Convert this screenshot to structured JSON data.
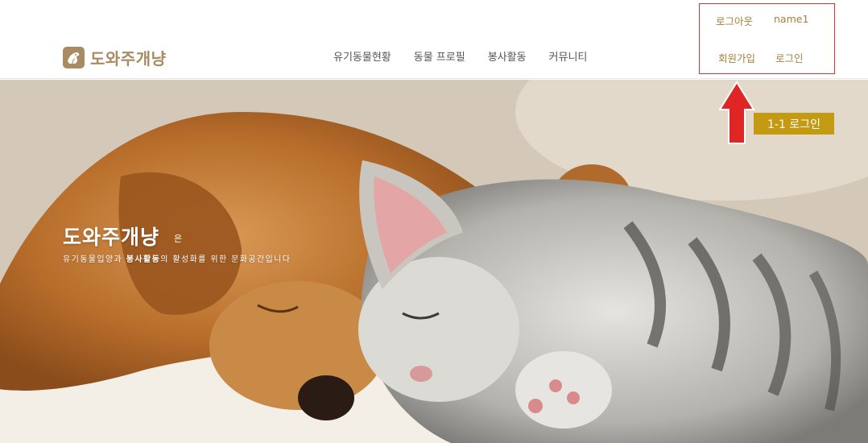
{
  "brand": {
    "name": "도와주개냥",
    "icon": "dog-cat-logo-icon",
    "color": "#a98b61"
  },
  "nav": {
    "items": [
      {
        "label": "유기동물현황"
      },
      {
        "label": "동물 프로필"
      },
      {
        "label": "봉사활동"
      },
      {
        "label": "커뮤니티"
      }
    ]
  },
  "auth": {
    "logout_label": "로그아웃",
    "user_name": "name1",
    "join_label": "회원가입",
    "login_label": "로그인",
    "link_color": "#a4803c",
    "highlight_color": "#e13030"
  },
  "hero": {
    "title": "도와주개냥",
    "title_suffix": "은",
    "subtitle_part1": "유기동물입양과 ",
    "subtitle_bold": "봉사활동",
    "subtitle_part2": "의 활성화를 위한 문화공간입니다"
  },
  "annotation": {
    "label": "1-1 로그인",
    "color": "#c49a12",
    "arrow_color": "#e02525"
  }
}
